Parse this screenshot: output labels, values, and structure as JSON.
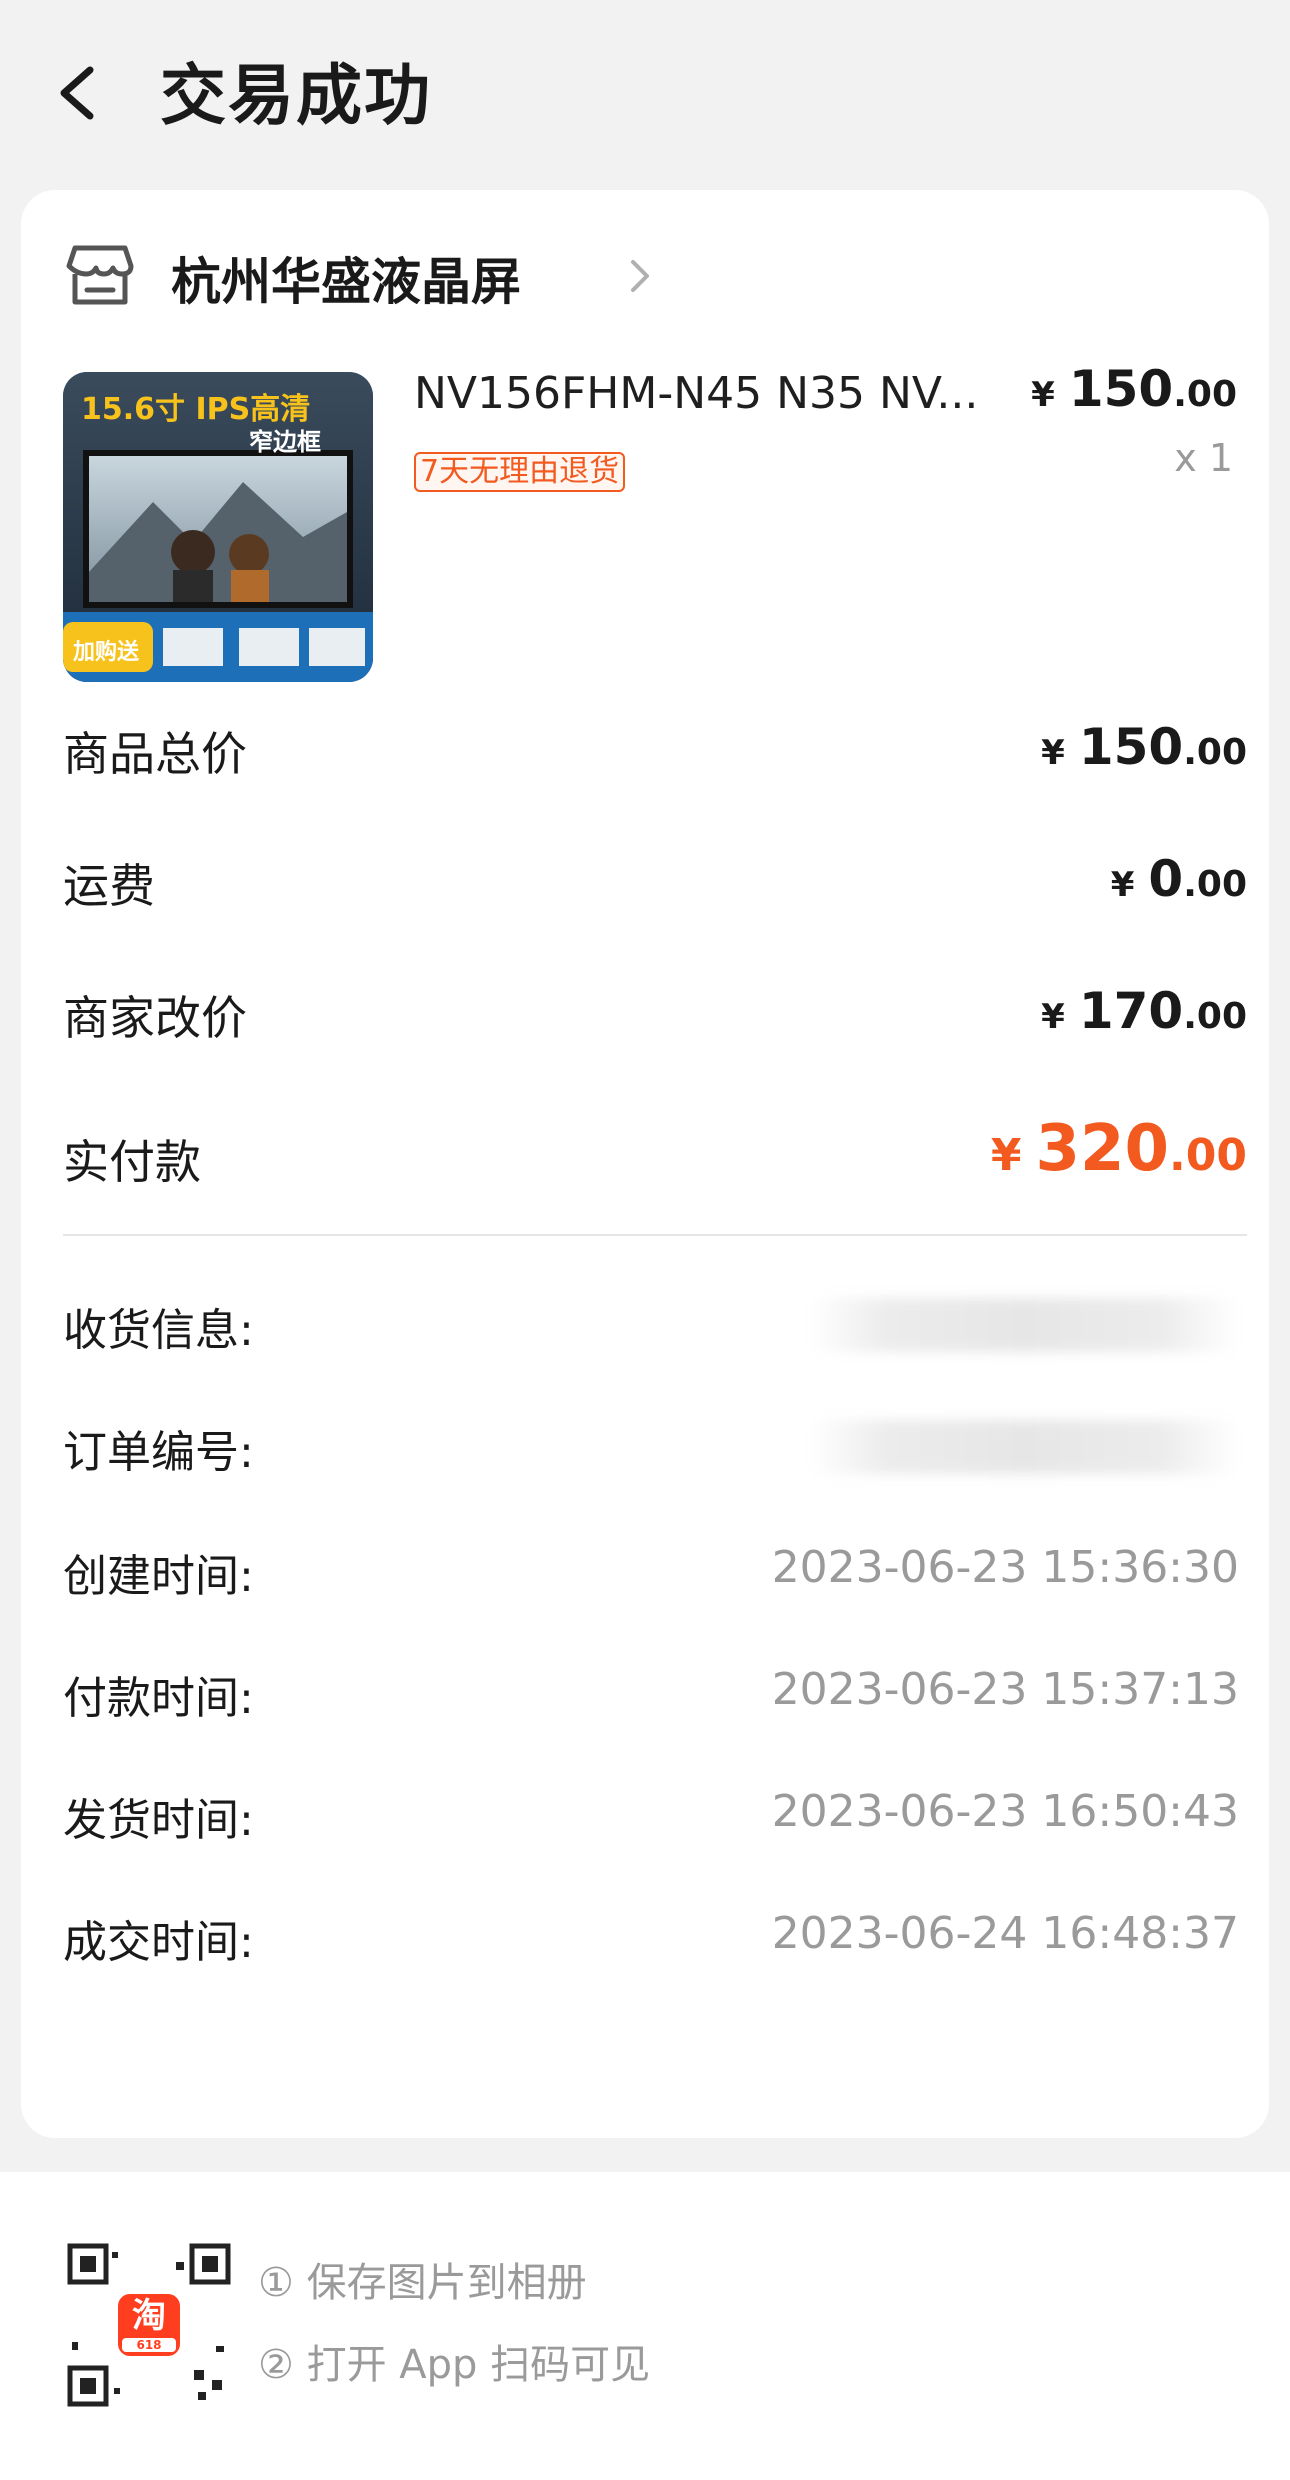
{
  "header": {
    "title": "交易成功"
  },
  "shop": {
    "name": "杭州华盛液晶屏"
  },
  "product": {
    "title": "NV156FHM-N45 N35 NV...",
    "badge": "7天无理由退货",
    "price_currency": "¥",
    "price_int": "150",
    "price_dec": ".00",
    "qty": "x 1",
    "image_text_main": "15.6寸 IPS高清",
    "image_text_sub": "窄边框",
    "image_tag": "加购送"
  },
  "summary": {
    "items": [
      {
        "label": "商品总价",
        "currency": "¥",
        "int": "150",
        "dec": ".00"
      },
      {
        "label": "运费",
        "currency": "¥",
        "int": "0",
        "dec": ".00"
      },
      {
        "label": "商家改价",
        "currency": "¥",
        "int": "170",
        "dec": ".00"
      }
    ],
    "paid": {
      "label": "实付款",
      "currency": "¥",
      "int": "320",
      "dec": ".00"
    }
  },
  "info": {
    "receiver_label": "收货信息:",
    "order_no_label": "订单编号:",
    "times": [
      {
        "label": "创建时间:",
        "value": "2023-06-23 15:36:30"
      },
      {
        "label": "付款时间:",
        "value": "2023-06-23 15:37:13"
      },
      {
        "label": "发货时间:",
        "value": "2023-06-23 16:50:43"
      },
      {
        "label": "成交时间:",
        "value": "2023-06-24 16:48:37"
      }
    ]
  },
  "footer": {
    "step1": "① 保存图片到相册",
    "step2": "② 打开 App 扫码可见",
    "app_badge": "淘",
    "app_badge_sub": "618"
  },
  "colors": {
    "accent": "#f25a1f",
    "muted": "#9a9a9a",
    "background": "#f2f2f2"
  }
}
